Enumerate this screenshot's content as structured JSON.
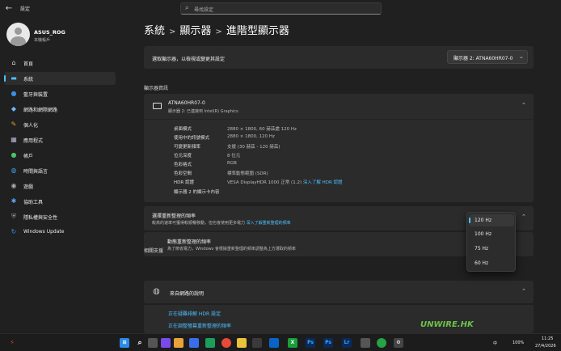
{
  "window": {
    "title": "設定"
  },
  "search": {
    "placeholder": "尋找設定"
  },
  "profile": {
    "name": "ASUS_ROG",
    "account_type": "本機帳戶"
  },
  "sidebar": {
    "items": [
      {
        "label": "首頁",
        "icon": "home-icon"
      },
      {
        "label": "系統",
        "icon": "system-icon"
      },
      {
        "label": "藍牙與裝置",
        "icon": "bluetooth-icon"
      },
      {
        "label": "網路和網際網路",
        "icon": "network-icon"
      },
      {
        "label": "個人化",
        "icon": "brush-icon"
      },
      {
        "label": "應用程式",
        "icon": "apps-icon"
      },
      {
        "label": "帳戶",
        "icon": "account-icon"
      },
      {
        "label": "時間與語言",
        "icon": "globe-clock-icon"
      },
      {
        "label": "遊戲",
        "icon": "gamepad-icon"
      },
      {
        "label": "協助工具",
        "icon": "accessibility-icon"
      },
      {
        "label": "隱私權與安全性",
        "icon": "shield-icon"
      },
      {
        "label": "Windows Update",
        "icon": "update-icon"
      }
    ]
  },
  "breadcrumb": {
    "part1": "系統",
    "sep": ">",
    "part2": "顯示器",
    "part3": "進階型顯示器"
  },
  "select_display": {
    "label": "選取顯示器，以檢視或變更其設定",
    "value": "顯示器 2: ATNA60HR07-0"
  },
  "display_info": {
    "section_title": "顯示器資訊",
    "device_name": "ATNA60HR07-0",
    "device_sub": "顯示器 2: 已連接到 Intel(R) Graphics",
    "rows": [
      {
        "key": "桌面模式",
        "value": "2880 × 1800, 60 赫茲處 120 Hz"
      },
      {
        "key": "使用中的訊號模式",
        "value": "2880 × 1800, 120 Hz"
      },
      {
        "key": "可變更新頻率",
        "value": "支援 (30 赫茲 - 120 赫茲)"
      },
      {
        "key": "位元深度",
        "value": "8 位元"
      },
      {
        "key": "色彩格式",
        "value": "RGB"
      },
      {
        "key": "色彩空間",
        "value": "標準動態範圍 (SDR)"
      },
      {
        "key": "HDR 認證",
        "value": "VESA DisplayHDR 1000 正常 (1.2)",
        "link": "深入了解 HDR 認證"
      }
    ],
    "adapter_link": "顯示器 2 的顯示卡內容"
  },
  "refresh_rate": {
    "title": "選擇重新整理的頻率",
    "desc": "較高的速率可獲得較順暢移動，但也會使用更多電力",
    "desc_link": "深入了解重新整理的頻率",
    "selected": "120 Hz",
    "options": [
      "120 Hz",
      "100 Hz",
      "75 Hz",
      "60 Hz"
    ]
  },
  "dynamic_refresh": {
    "title": "動態重新整理的頻率",
    "desc": "為了節省電力，Windows 會根據重新整理的頻率調整為上方選取的頻率"
  },
  "related": {
    "section_title": "相關支援",
    "help_title": "來自網路的說明",
    "links": [
      "正在疑難排解 HDR 設定",
      "正在調整螢幕重新整理的頻率"
    ]
  },
  "taskbar": {
    "time": "11:25",
    "date": "27/4/2026",
    "battery": "100%",
    "lang": "中",
    "icons": [
      "start-icon",
      "search-icon",
      "files-icon",
      "app-icon",
      "store-icon",
      "chrome-icon",
      "edge-icon",
      "folder-icon",
      "terminal-icon",
      "photoshop-icon",
      "lightroom-icon",
      "photoshop-icon-2",
      "settings-icon",
      "xbox-icon"
    ]
  },
  "watermark": "UNWIRE.HK"
}
